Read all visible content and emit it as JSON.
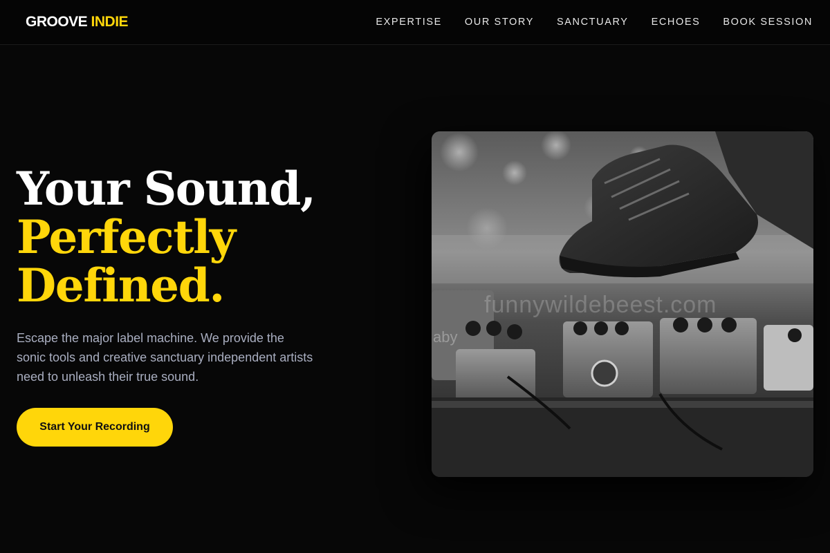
{
  "header": {
    "logo_part1": "GROOVE",
    "logo_part2": "INDIE",
    "nav": [
      "EXPERTISE",
      "OUR STORY",
      "SANCTUARY",
      "ECHOES",
      "BOOK SESSION"
    ]
  },
  "hero": {
    "title_line1": "Your Sound,",
    "title_line2": "Perfectly",
    "title_line3": "Defined.",
    "description": "Escape the major label machine. We provide the sonic tools and creative sanctuary independent artists need to unleash their true sound.",
    "cta_label": "Start Your Recording"
  },
  "image": {
    "subject": "sneaker-over-guitar-pedalboard-photo",
    "watermark": "funnywildebeest.com",
    "pedal_label": "aby"
  },
  "colors": {
    "accent": "#ffd60a",
    "background": "#070707",
    "text_muted": "#a9aec0"
  }
}
